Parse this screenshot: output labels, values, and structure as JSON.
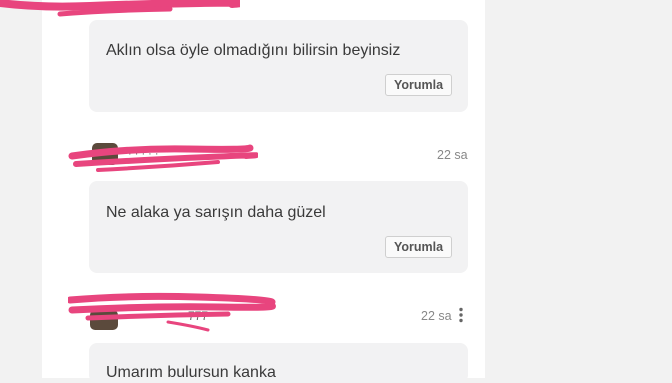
{
  "comments": [
    {
      "text": "Aklın olsa öyle olmadığını bilirsin beyinsiz",
      "reply_label": "Yorumla"
    },
    {
      "time": "22 sa",
      "username_fragment": "· · · · ·",
      "text": "Ne alaka ya sarışın daha güzel",
      "reply_label": "Yorumla"
    },
    {
      "time": "22 sa",
      "username_fragment": "777",
      "text": "Umarım bulursun kanka"
    }
  ],
  "colors": {
    "redaction": "#e8457e",
    "bubble": "#f2f2f3",
    "page": "#f2f2f2"
  },
  "icons": {
    "more": "more-vertical-icon"
  }
}
